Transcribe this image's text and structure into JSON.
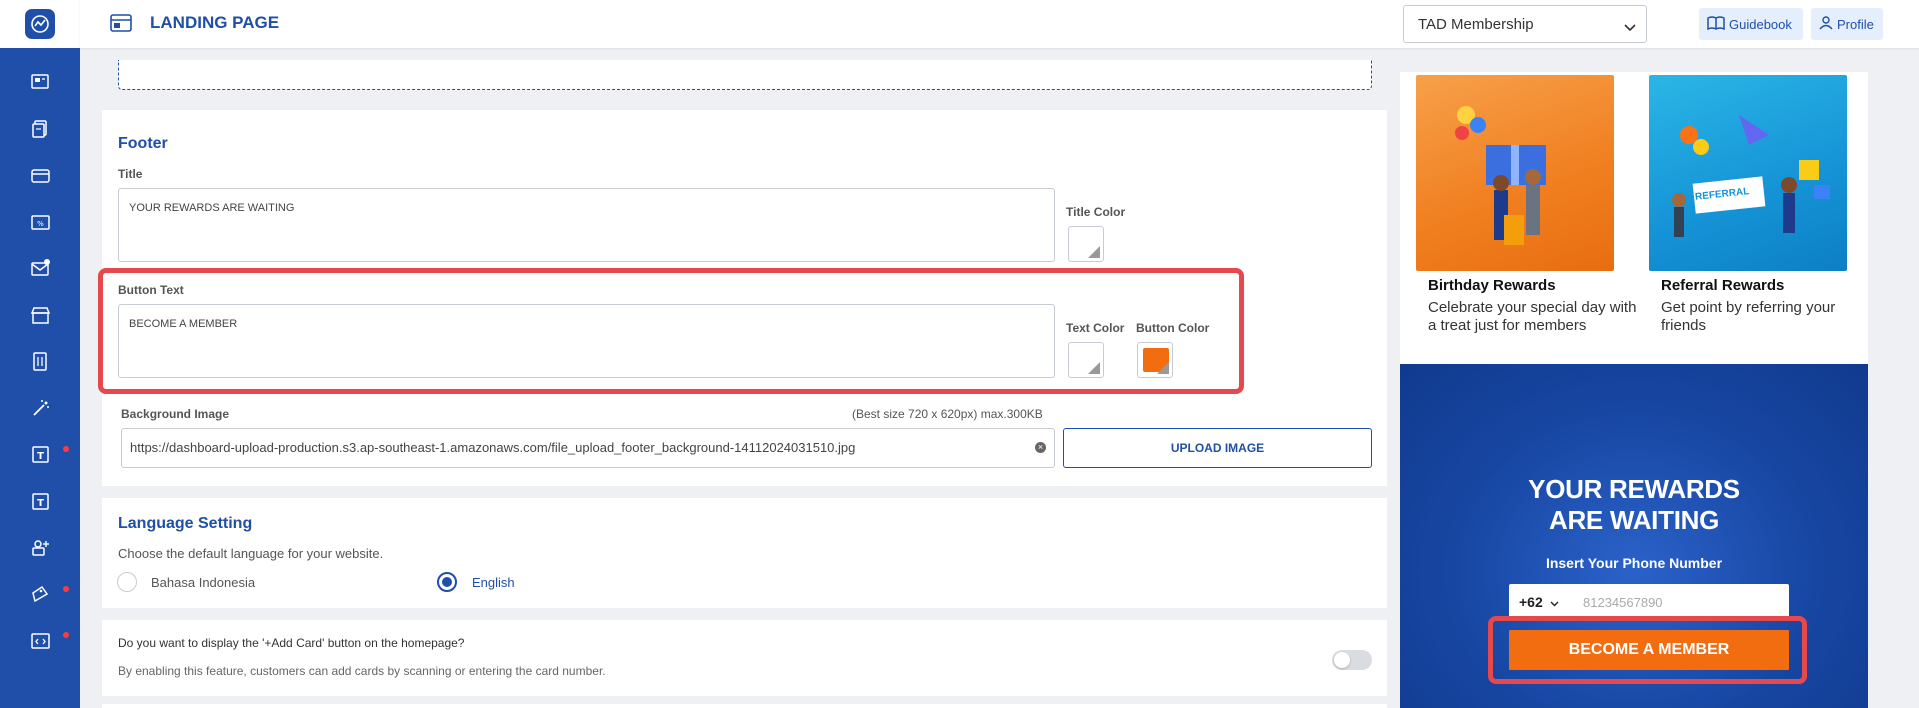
{
  "header": {
    "page_title": "LANDING PAGE",
    "program_select": "TAD Membership",
    "guidebook_label": "Guidebook",
    "profile_label": "Profile"
  },
  "sidebar": {
    "items": [
      {
        "icon": "dashboard-icon",
        "badge": false
      },
      {
        "icon": "documents-icon",
        "badge": false
      },
      {
        "icon": "card-icon",
        "badge": false
      },
      {
        "icon": "voucher-icon",
        "badge": false
      },
      {
        "icon": "mail-icon",
        "badge": true
      },
      {
        "icon": "store-icon",
        "badge": false
      },
      {
        "icon": "menu-icon",
        "badge": false
      },
      {
        "icon": "magic-wand-icon",
        "badge": false
      },
      {
        "icon": "ticket-icon",
        "badge": true
      },
      {
        "icon": "ticket-alt-icon",
        "badge": false
      },
      {
        "icon": "user-add-icon",
        "badge": false
      },
      {
        "icon": "tag-icon",
        "badge": true
      },
      {
        "icon": "code-icon",
        "badge": true
      }
    ]
  },
  "footer_section": {
    "title": "Footer",
    "title_label": "Title",
    "title_value": "YOUR REWARDS ARE WAITING",
    "title_color_label": "Title Color",
    "button_text_label": "Button Text",
    "button_text_value": "BECOME A MEMBER",
    "text_color_label": "Text Color",
    "button_color_label": "Button Color",
    "button_color": "#f26d0f",
    "bg_image_label": "Background Image",
    "bg_image_hint": "(Best size 720 x 620px) max.300KB",
    "bg_image_url": "https://dashboard-upload-production.s3.ap-southeast-1.amazonaws.com/file_upload_footer_background-14112024031510.jpg",
    "upload_label": "UPLOAD IMAGE"
  },
  "language_section": {
    "title": "Language Setting",
    "description": "Choose the default language for your website.",
    "options": [
      "Bahasa Indonesia",
      "English"
    ],
    "selected": "English"
  },
  "add_card_section": {
    "question": "Do you want to display the '+Add Card' button on the homepage?",
    "description": "By enabling this feature, customers can add cards by scanning or entering the card number.",
    "enabled": false
  },
  "preview": {
    "rewards": [
      {
        "title": "Birthday Rewards",
        "desc": "Celebrate your special day with a treat just for members"
      },
      {
        "title": "Referral Rewards",
        "desc": "Get point by referring your friends",
        "banner": "REFERRAL"
      }
    ],
    "hero_title": "YOUR REWARDS ARE WAITING",
    "hero_sub": "Insert Your Phone Number",
    "phone_code": "+62",
    "phone_placeholder": "81234567890",
    "cta": "BECOME A MEMBER"
  },
  "colors": {
    "brand": "#1f4fa8",
    "accent": "#f26d0f",
    "highlight": "#e5484d"
  }
}
